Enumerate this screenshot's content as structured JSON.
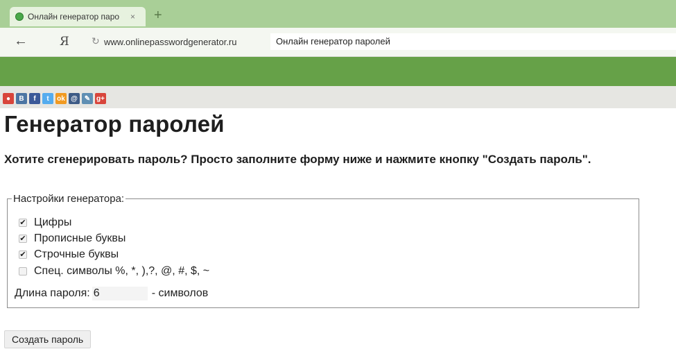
{
  "browser": {
    "tab_title": "Онлайн генератор паро",
    "tab_close": "×",
    "new_tab": "+",
    "back": "←",
    "yandex_logo": "Я",
    "reload": "↻",
    "url": "www.onlinepasswordgenerator.ru",
    "page_title_in_bar": "Онлайн генератор паролей"
  },
  "social": {
    "icons": [
      {
        "name": "google-icon",
        "glyph": "●",
        "color": "#d8453b"
      },
      {
        "name": "vk-icon",
        "glyph": "B",
        "color": "#4c75a3"
      },
      {
        "name": "facebook-icon",
        "glyph": "f",
        "color": "#3b5998"
      },
      {
        "name": "twitter-icon",
        "glyph": "t",
        "color": "#55acee"
      },
      {
        "name": "odnoklassniki-icon",
        "glyph": "ok",
        "color": "#f19a21"
      },
      {
        "name": "moimir-icon",
        "glyph": "@",
        "color": "#3e5b86"
      },
      {
        "name": "livejournal-icon",
        "glyph": "✎",
        "color": "#5f8fb3"
      },
      {
        "name": "googleplus-icon",
        "glyph": "g+",
        "color": "#d8453b"
      }
    ]
  },
  "page": {
    "title": "Генератор паролей",
    "intro": "Хотите сгенерировать пароль? Просто заполните форму ниже и нажмите кнопку \"Создать пароль\"."
  },
  "settings": {
    "legend": "Настройки генератора:",
    "options": [
      {
        "label": "Цифры",
        "checked": true
      },
      {
        "label": "Прописные буквы",
        "checked": true
      },
      {
        "label": "Строчные буквы",
        "checked": true
      },
      {
        "label": "Спец. символы %, *, ),?, @, #, $, ~",
        "checked": false
      }
    ],
    "length_label": "Длина пароля:",
    "length_value": "6",
    "length_unit": "- символов"
  },
  "actions": {
    "create_label": "Создать пароль"
  },
  "colors": {
    "tabbar": "#a9cf97",
    "header_band": "#66a148"
  }
}
